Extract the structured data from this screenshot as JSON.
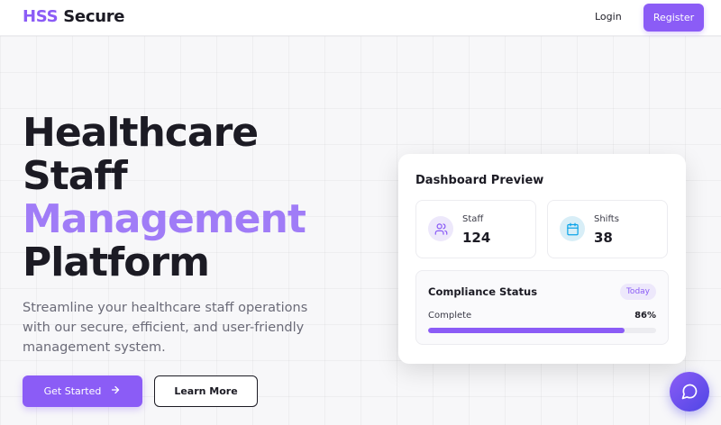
{
  "brand": {
    "accent_text": "HSS",
    "rest_text": "Secure",
    "accent_color": "#8b5cf6"
  },
  "nav": {
    "login_label": "Login",
    "register_label": "Register"
  },
  "hero": {
    "title_lines": [
      "Healthcare",
      "Staff",
      "Management",
      "Platform"
    ],
    "subtitle": "Streamline your healthcare staff operations with our secure, efficient, and user-friendly management system.",
    "primary_button": "Get Started",
    "primary_icon": "arrow-right-icon",
    "secondary_button": "Learn More"
  },
  "dashboard": {
    "title": "Dashboard Preview",
    "stats": [
      {
        "label": "Staff",
        "value": "124",
        "icon": "users-icon",
        "color": "#8b5cf6"
      },
      {
        "label": "Shifts",
        "value": "38",
        "icon": "calendar-icon",
        "color": "#0ea5e9"
      }
    ],
    "compliance": {
      "title": "Compliance Status",
      "badge": "Today",
      "label": "Complete",
      "percent_text": "86%",
      "percent": 86
    }
  },
  "chat": {
    "icon": "chat-bubble-icon"
  }
}
